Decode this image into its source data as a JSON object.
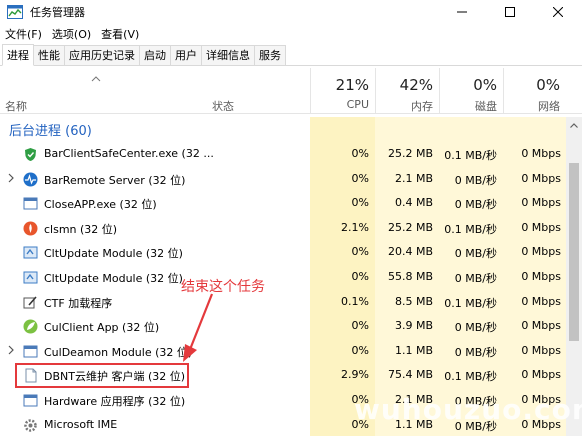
{
  "window": {
    "title": "任务管理器"
  },
  "menu": [
    "文件(F)",
    "选项(O)",
    "查看(V)"
  ],
  "tabs": [
    "进程",
    "性能",
    "应用历史记录",
    "启动",
    "用户",
    "详细信息",
    "服务"
  ],
  "columns": {
    "name": "名称",
    "status": "状态",
    "cpu": {
      "pct": "21%",
      "label": "CPU"
    },
    "memory": {
      "pct": "42%",
      "label": "内存"
    },
    "disk": {
      "pct": "0%",
      "label": "磁盘"
    },
    "network": {
      "pct": "0%",
      "label": "网络"
    }
  },
  "group": {
    "title": "后台进程 (60)"
  },
  "processes": [
    {
      "name": "BarClientSafeCenter.exe (32 ...",
      "cpu": "0%",
      "mem": "25.2 MB",
      "disk": "0.1 MB/秒",
      "net": "0 Mbps",
      "icon": "shield-icon",
      "expandable": false
    },
    {
      "name": "BarRemote Server (32 位)",
      "cpu": "0%",
      "mem": "2.1 MB",
      "disk": "0 MB/秒",
      "net": "0 Mbps",
      "icon": "pulse-icon",
      "expandable": true
    },
    {
      "name": "CloseAPP.exe (32 位)",
      "cpu": "0%",
      "mem": "0.4 MB",
      "disk": "0 MB/秒",
      "net": "0 Mbps",
      "icon": "window-icon",
      "expandable": false
    },
    {
      "name": "clsmn (32 位)",
      "cpu": "2.1%",
      "mem": "25.2 MB",
      "disk": "0.1 MB/秒",
      "net": "0 Mbps",
      "icon": "orange-app-icon",
      "expandable": false
    },
    {
      "name": "CltUpdate Module (32 位)",
      "cpu": "0%",
      "mem": "20.4 MB",
      "disk": "0 MB/秒",
      "net": "0 Mbps",
      "icon": "update-icon",
      "expandable": false
    },
    {
      "name": "CltUpdate Module (32 位)",
      "cpu": "0%",
      "mem": "55.8 MB",
      "disk": "0 MB/秒",
      "net": "0 Mbps",
      "icon": "update-icon",
      "expandable": false
    },
    {
      "name": "CTF 加载程序",
      "cpu": "0.1%",
      "mem": "8.5 MB",
      "disk": "0.1 MB/秒",
      "net": "0 Mbps",
      "icon": "pen-icon",
      "expandable": false
    },
    {
      "name": "CulClient App (32 位)",
      "cpu": "0%",
      "mem": "3.9 MB",
      "disk": "0 MB/秒",
      "net": "0 Mbps",
      "icon": "green-leaf-icon",
      "expandable": false
    },
    {
      "name": "CulDeamon Module (32 位)",
      "cpu": "0%",
      "mem": "1.1 MB",
      "disk": "0 MB/秒",
      "net": "0 Mbps",
      "icon": "window-icon",
      "expandable": true
    },
    {
      "name": "DBNT云维护 客户端 (32 位)",
      "cpu": "2.9%",
      "mem": "75.4 MB",
      "disk": "0.1 MB/秒",
      "net": "0 Mbps",
      "icon": "document-icon",
      "expandable": false
    },
    {
      "name": "Hardware 应用程序 (32 位)",
      "cpu": "0%",
      "mem": "2.1 MB",
      "disk": "0 MB/秒",
      "net": "0 Mbps",
      "icon": "window-icon",
      "expandable": false
    },
    {
      "name": "Microsoft IME",
      "cpu": "0%",
      "mem": "1.1 MB",
      "disk": "0 MB/秒",
      "net": "0 Mbps",
      "icon": "gear-icon",
      "expandable": false
    }
  ],
  "annotation": {
    "text": "结束这个任务",
    "color": "#e4393c"
  },
  "watermark": "wuhouzuo.com",
  "colors": {
    "group_title": "#2463c0",
    "cpu_bg": "#fdf4c4",
    "other_bg": "#fff9dc",
    "highlight": "#e4393c"
  }
}
